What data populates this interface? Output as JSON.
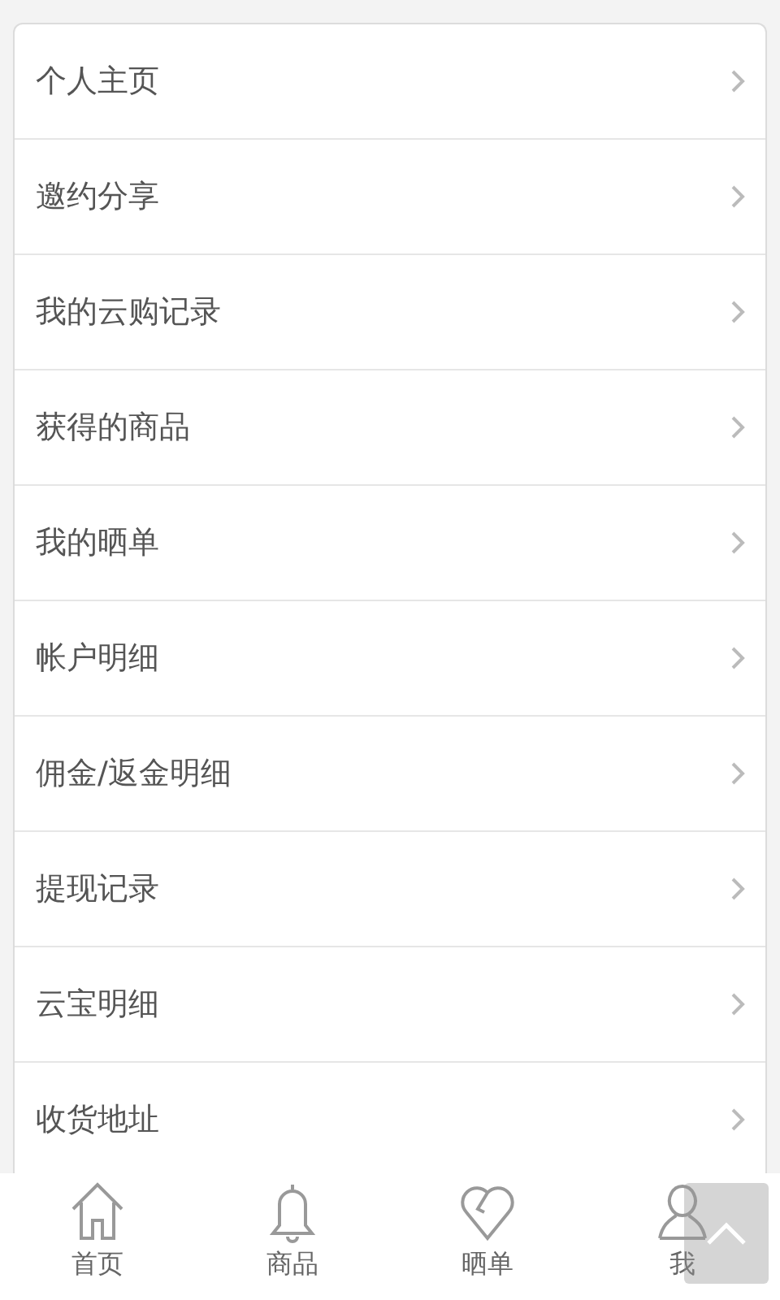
{
  "menu": [
    {
      "label": "个人主页"
    },
    {
      "label": "邀约分享"
    },
    {
      "label": "我的云购记录"
    },
    {
      "label": "获得的商品"
    },
    {
      "label": "我的晒单"
    },
    {
      "label": "帐户明细"
    },
    {
      "label": "佣金/返金明细"
    },
    {
      "label": "提现记录"
    },
    {
      "label": "云宝明细"
    },
    {
      "label": "收货地址"
    }
  ],
  "tab_bar": [
    {
      "label": "首页",
      "kind": "home"
    },
    {
      "label": "商品",
      "kind": "bell"
    },
    {
      "label": "晒单",
      "kind": "heart"
    },
    {
      "label": "我",
      "kind": "person"
    }
  ]
}
